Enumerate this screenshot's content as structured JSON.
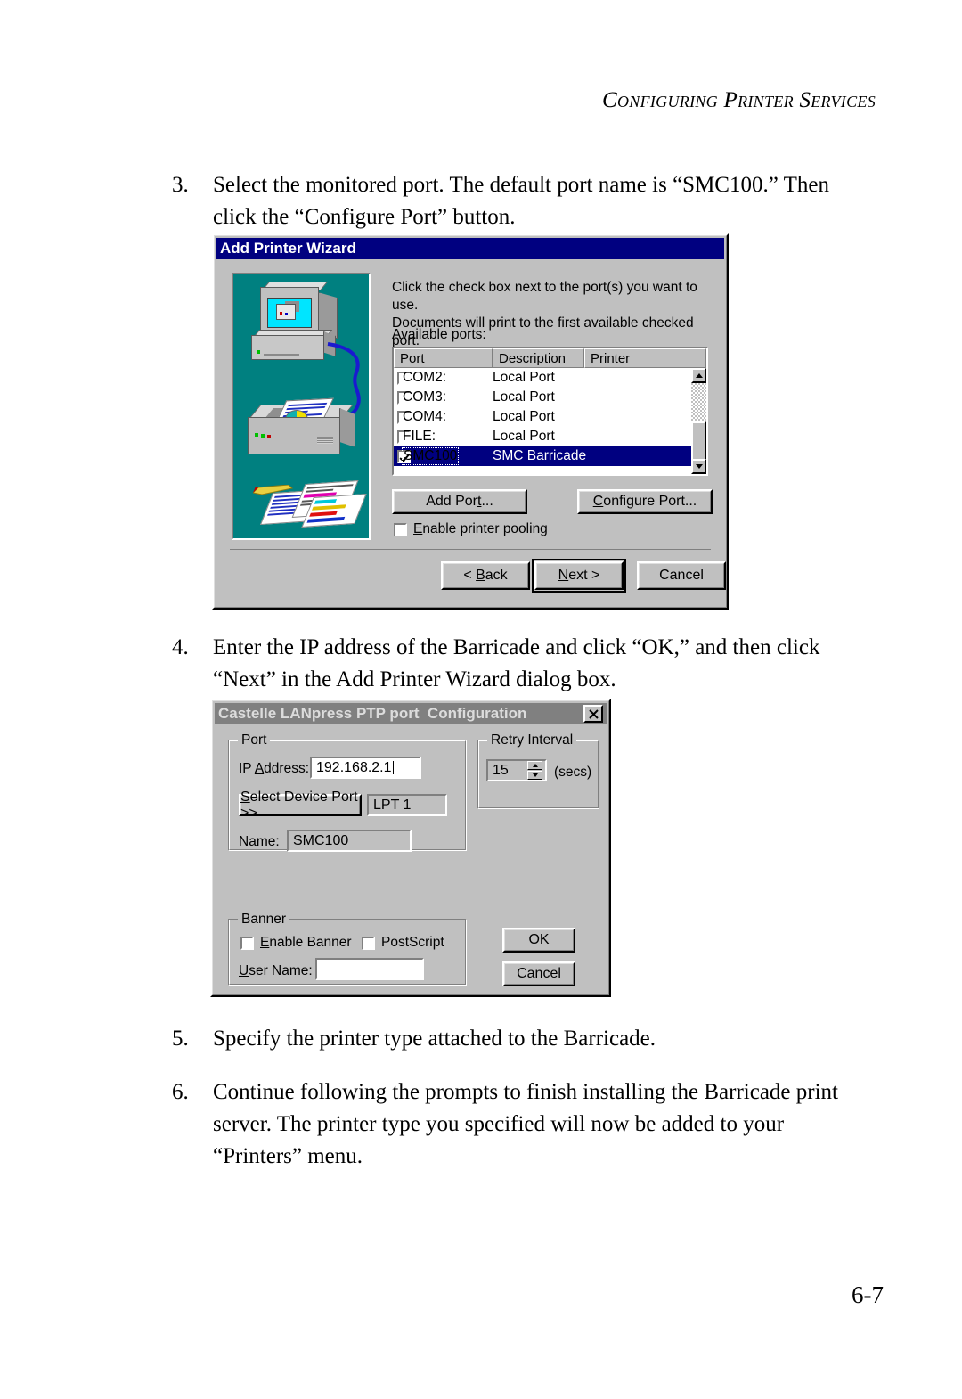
{
  "page": {
    "header": "Configuring Printer Services",
    "number": "6-7"
  },
  "steps": [
    {
      "num": "3.",
      "text": "Select the monitored port. The default port name is “SMC100.” Then click the “Configure Port” button."
    },
    {
      "num": "4.",
      "text": "Enter the IP address of the Barricade and click “OK,” and then click “Next” in the Add Printer Wizard dialog box."
    },
    {
      "num": "5.",
      "text": "Specify the printer type attached to the Barricade."
    },
    {
      "num": "6.",
      "text": "Continue following the prompts to finish installing the Barricade print server. The printer type you specified will now be added to your “Printers” menu."
    }
  ],
  "wizard": {
    "title": "Add Printer Wizard",
    "instruction_line1": "Click the check box next to the port(s) you want to use.",
    "instruction_line2": "Documents will print to the first available checked port.",
    "available_ports_label": "Available ports:",
    "columns": [
      "Port",
      "Description",
      "Printer"
    ],
    "rows": [
      {
        "checked": false,
        "port": "COM2:",
        "description": "Local Port",
        "printer": "",
        "selected": false
      },
      {
        "checked": false,
        "port": "COM3:",
        "description": "Local Port",
        "printer": "",
        "selected": false
      },
      {
        "checked": false,
        "port": "COM4:",
        "description": "Local Port",
        "printer": "",
        "selected": false
      },
      {
        "checked": false,
        "port": "FILE:",
        "description": "Local Port",
        "printer": "",
        "selected": false
      },
      {
        "checked": true,
        "port": "SMC100",
        "description": "SMC Barricade",
        "printer": "",
        "selected": true
      }
    ],
    "add_port_button": "Add Port...",
    "configure_port_button": "Configure Port...",
    "enable_pooling_label": "Enable printer pooling",
    "enable_pooling_checked": false,
    "back_button": "< Back",
    "next_button": "Next >",
    "cancel_button": "Cancel",
    "colors": {
      "titlebar": "#000080",
      "face": "#c0c0c0",
      "illustration_bg": "#008080",
      "selection": "#000080"
    }
  },
  "config": {
    "title": "Castelle LANpress PTP port  Configuration",
    "close_button": "✕",
    "port_group_title": "Port",
    "ip_address_label": "IP Address:",
    "ip_address_value": "192.168.2.1",
    "select_device_port_button": "Select Device Port >>",
    "device_port_value": "LPT 1",
    "name_label": "Name:",
    "name_value": "SMC100",
    "retry_group_title": "Retry Interval",
    "retry_value": "15",
    "retry_units": "(secs)",
    "banner_group_title": "Banner",
    "enable_banner_label": "Enable Banner",
    "enable_banner_checked": false,
    "postscript_label": "PostScript",
    "postscript_checked": false,
    "user_name_label": "User Name:",
    "user_name_value": "",
    "ok_button": "OK",
    "cancel_button": "Cancel",
    "colors": {
      "titlebar_inactive": "#808080",
      "face": "#c0c0c0"
    }
  }
}
